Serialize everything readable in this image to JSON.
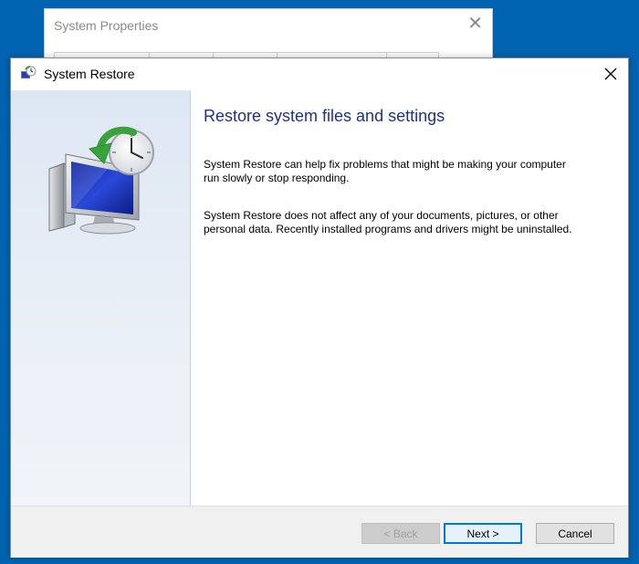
{
  "background_window": {
    "title": "System Properties",
    "close_glyph": "✕",
    "tabs": [
      "",
      "",
      "",
      "",
      ""
    ]
  },
  "dialog": {
    "title": "System Restore",
    "close_glyph": "✕",
    "icon": "system-restore-icon"
  },
  "content": {
    "heading": "Restore system files and settings",
    "paragraph1": "System Restore can help fix problems that might be making your computer run slowly or stop responding.",
    "paragraph2": "System Restore does not affect any of your documents, pictures, or other personal data. Recently installed programs and drivers might be uninstalled."
  },
  "footer": {
    "back_label": "< Back",
    "next_label": "Next >",
    "cancel_label": "Cancel"
  },
  "colors": {
    "desktop": "#0063b1",
    "heading": "#1e3287",
    "focus_border": "#0078d7"
  }
}
